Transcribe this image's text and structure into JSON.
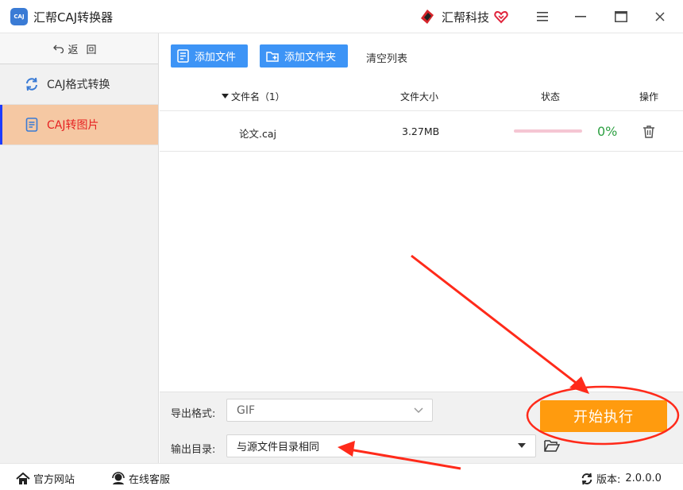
{
  "app": {
    "logo_text": "CAJ",
    "title": "汇帮CAJ转换器",
    "brand_name": "汇帮科技"
  },
  "sidebar": {
    "back_label": "返回",
    "items": [
      {
        "label": "CAJ格式转换",
        "icon": "refresh-icon",
        "active": false
      },
      {
        "label": "CAJ转图片",
        "icon": "document-icon",
        "active": true
      }
    ]
  },
  "toolbar": {
    "add_file_label": "添加文件",
    "add_folder_label": "添加文件夹",
    "clear_list_label": "清空列表"
  },
  "table": {
    "col_name": "文件名（1）",
    "col_size": "文件大小",
    "col_status": "状态",
    "col_action": "操作",
    "rows": [
      {
        "name": "论文.caj",
        "size": "3.27MB",
        "progress": 0,
        "progress_text": "0%"
      }
    ]
  },
  "settings": {
    "format_label": "导出格式:",
    "format_value": "GIF",
    "output_label": "输出目录:",
    "output_value": "与源文件目录相同",
    "start_label": "开始执行"
  },
  "statusbar": {
    "website_label": "官方网站",
    "support_label": "在线客服",
    "version_label": "版本:",
    "version_value": "2.0.0.0"
  },
  "colors": {
    "accent_blue": "#3d94f6",
    "start_orange": "#ff9b0e",
    "active_nav_bg": "#f5c8a3",
    "active_nav_text": "#e62222",
    "progress_pct": "#2ea043",
    "annotation_red": "#ff2a1a"
  }
}
